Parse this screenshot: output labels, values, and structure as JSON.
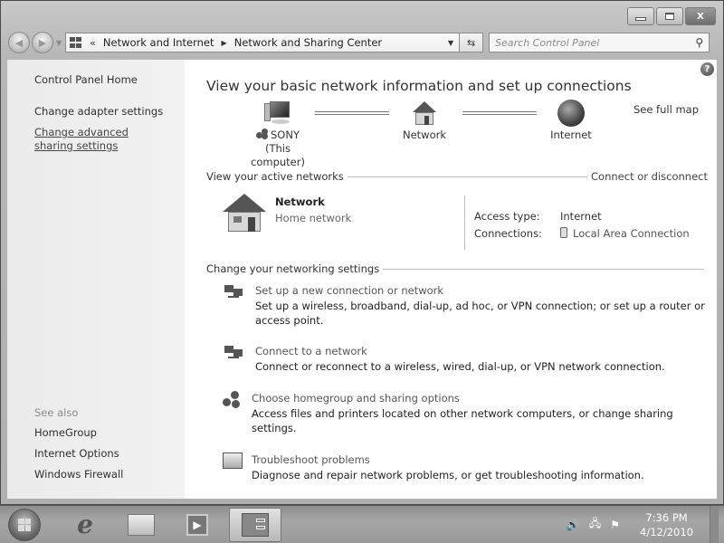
{
  "window": {
    "controls": {
      "minimize": "minimize",
      "maximize": "maximize",
      "close": "X"
    }
  },
  "navbar": {
    "back_icon": "back-arrow-icon",
    "forward_icon": "forward-arrow-icon",
    "overflow": "«",
    "breadcrumbs": [
      "Network and Internet",
      "Network and Sharing Center"
    ],
    "search_placeholder": "Search Control Panel"
  },
  "sidebar": {
    "home": "Control Panel Home",
    "links": [
      "Change adapter settings",
      "Change advanced sharing settings"
    ],
    "see_also_label": "See also",
    "see_also": [
      "HomeGroup",
      "Internet Options",
      "Windows Firewall"
    ]
  },
  "main": {
    "help": "?",
    "title": "View your basic network information and set up connections",
    "see_full_map": "See full map",
    "map": {
      "computer_name": "SONY",
      "computer_sub": "(This computer)",
      "network": "Network",
      "internet": "Internet"
    },
    "active_networks": {
      "heading": "View your active networks",
      "action": "Connect or disconnect",
      "network_name": "Network",
      "network_type": "Home network",
      "access_type_label": "Access type:",
      "access_type_value": "Internet",
      "connections_label": "Connections:",
      "connections_value": "Local Area Connection"
    },
    "settings": {
      "heading": "Change your networking settings",
      "tasks": [
        {
          "title": "Set up a new connection or network",
          "desc": "Set up a wireless, broadband, dial-up, ad hoc, or VPN connection; or set up a router or access point.",
          "icon": "new-connection-icon"
        },
        {
          "title": "Connect to a network",
          "desc": "Connect or reconnect to a wireless, wired, dial-up, or VPN network connection.",
          "icon": "connect-network-icon"
        },
        {
          "title": "Choose homegroup and sharing options",
          "desc": "Access files and printers located on other network computers, or change sharing settings.",
          "icon": "homegroup-icon"
        },
        {
          "title": "Troubleshoot problems",
          "desc": "Diagnose and repair network problems, or get troubleshooting information.",
          "icon": "troubleshoot-icon"
        }
      ]
    }
  },
  "taskbar": {
    "apps": [
      "Internet Explorer",
      "Windows Explorer",
      "Windows Media Player",
      "Control Panel"
    ],
    "tray": {
      "volume": "🔊",
      "network": "network-tray-icon",
      "action_center": "action-center-icon"
    },
    "time": "7:36 PM",
    "date": "4/12/2010"
  }
}
